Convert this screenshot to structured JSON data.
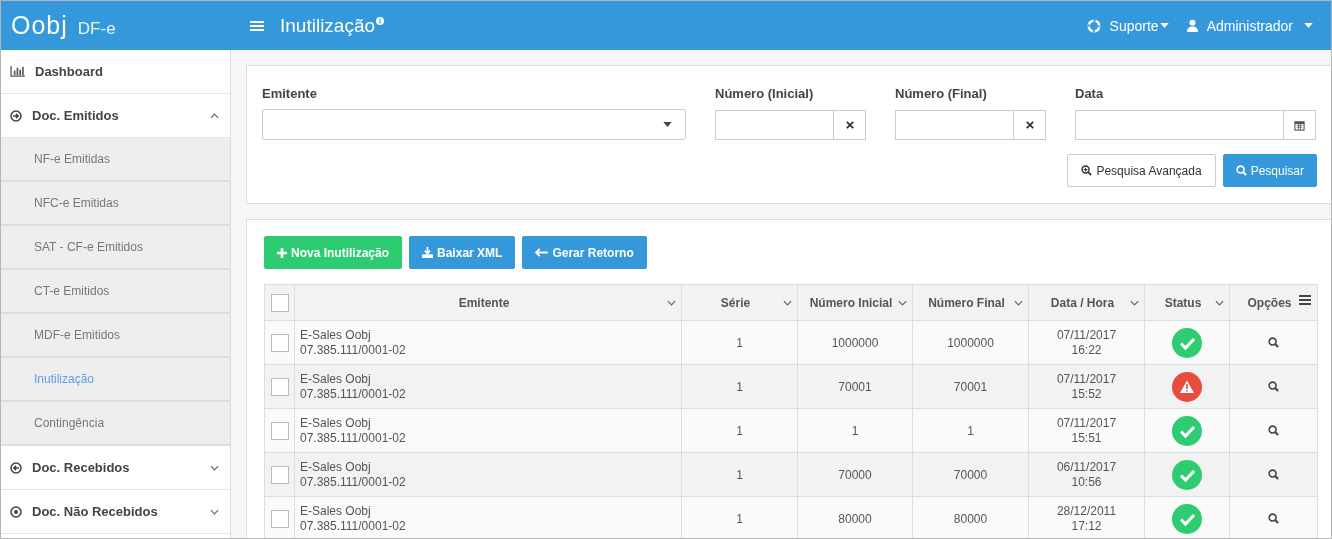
{
  "header": {
    "brand": "Oobj",
    "product": "DF-e",
    "title": "Inutilização",
    "menus": [
      {
        "kind": "support",
        "label": "Suporte"
      },
      {
        "kind": "user",
        "label": "Administrador"
      }
    ]
  },
  "sidebar": {
    "items": [
      {
        "kind": "chart",
        "label": "Dashboard"
      },
      {
        "kind": "out",
        "label": "Doc. Emitidos",
        "expanded": true,
        "children": [
          {
            "label": "NF-e Emitidas",
            "selected": false
          },
          {
            "label": "NFC-e Emitidas",
            "selected": false
          },
          {
            "label": "SAT - CF-e Emitidos",
            "selected": false
          },
          {
            "label": "CT-e Emitidos",
            "selected": false
          },
          {
            "label": "MDF-e Emitidos",
            "selected": false
          },
          {
            "label": "Inutilização",
            "selected": true
          },
          {
            "label": "Contingência",
            "selected": false
          }
        ]
      },
      {
        "kind": "in",
        "label": "Doc. Recebidos",
        "expanded": false
      },
      {
        "kind": "dot",
        "label": "Doc. Não Recebidos",
        "expanded": false
      }
    ]
  },
  "filters": {
    "fields": [
      {
        "kind": "select",
        "label": "Emitente"
      },
      {
        "kind": "clear",
        "label": "Número (Inicial)"
      },
      {
        "kind": "clear",
        "label": "Número (Final)"
      },
      {
        "kind": "date",
        "label": "Data"
      }
    ],
    "buttons": [
      {
        "kind": "advanced",
        "label": "Pesquisa Avançada"
      },
      {
        "kind": "search",
        "label": "Pesquisar"
      }
    ]
  },
  "actions": [
    {
      "kind": "add",
      "label": "Nova Inutilização"
    },
    {
      "kind": "download",
      "label": "Baixar XML"
    },
    {
      "kind": "back",
      "label": "Gerar Retorno"
    }
  ],
  "table": {
    "select_all": false,
    "columns": [
      {
        "label": "Emitente",
        "kind": "sort"
      },
      {
        "label": "Série",
        "kind": "sort"
      },
      {
        "label": "Número Inicial",
        "kind": "sort"
      },
      {
        "label": "Número Final",
        "kind": "sort"
      },
      {
        "label": "Data / Hora",
        "kind": "sort"
      },
      {
        "label": "Status",
        "kind": "sort"
      },
      {
        "label": "Opções",
        "kind": "menu"
      }
    ],
    "rows": [
      {
        "checked": false,
        "emitente": "E-Sales Oobj",
        "cnpj": "07.385.111/0001-02",
        "serie": "1",
        "inicial": "1000000",
        "final": "1000000",
        "date": "07/11/2017",
        "time": "16:22",
        "kind": "ok"
      },
      {
        "checked": false,
        "emitente": "E-Sales Oobj",
        "cnpj": "07.385.111/0001-02",
        "serie": "1",
        "inicial": "70001",
        "final": "70001",
        "date": "07/11/2017",
        "time": "15:52",
        "kind": "error"
      },
      {
        "checked": false,
        "emitente": "E-Sales Oobj",
        "cnpj": "07.385.111/0001-02",
        "serie": "1",
        "inicial": "1",
        "final": "1",
        "date": "07/11/2017",
        "time": "15:51",
        "kind": "ok"
      },
      {
        "checked": false,
        "emitente": "E-Sales Oobj",
        "cnpj": "07.385.111/0001-02",
        "serie": "1",
        "inicial": "70000",
        "final": "70000",
        "date": "06/11/2017",
        "time": "10:56",
        "kind": "ok"
      },
      {
        "checked": false,
        "emitente": "E-Sales Oobj",
        "cnpj": "07.385.111/0001-02",
        "serie": "1",
        "inicial": "80000",
        "final": "80000",
        "date": "28/12/2011",
        "time": "17:12",
        "kind": "ok"
      }
    ]
  }
}
